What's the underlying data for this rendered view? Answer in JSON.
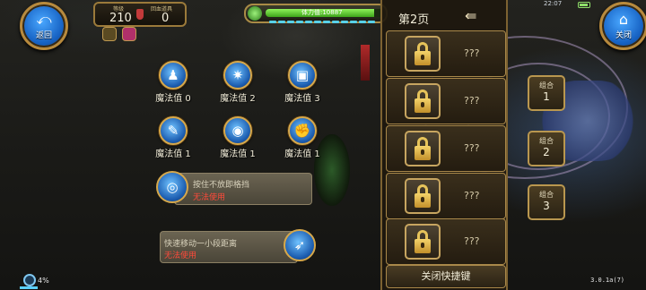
{
  "hud": {
    "back_label": "返回",
    "close_label": "关闭",
    "level_caption": "等级",
    "level_value": "210",
    "potion_caption": "回血道具",
    "potion_value": "0",
    "stamina_text": "体力值:10887",
    "clock": "22:07",
    "hp_fraction": 0.92
  },
  "skills": [
    {
      "name": "魔法值 0",
      "icon": "green-figure-icon"
    },
    {
      "name": "魔法值 2",
      "icon": "star-burst-icon"
    },
    {
      "name": "魔法值 3",
      "icon": "chest-icon"
    },
    {
      "name": "魔法值 1",
      "icon": "feather-icon"
    },
    {
      "name": "魔法值 1",
      "icon": "eye-icon"
    },
    {
      "name": "魔法值 1",
      "icon": "fist-icon"
    }
  ],
  "cards": [
    {
      "text": "按住不放即格挡",
      "status": "无法使用",
      "icon": "shield-icon"
    },
    {
      "text": "快速移动一小段距离",
      "status": "无法使用",
      "icon": "boot-icon"
    }
  ],
  "shortcuts": {
    "page_label": "第2页",
    "slots": [
      "???",
      "???",
      "???",
      "???",
      "???"
    ],
    "close_button": "关闭快捷键"
  },
  "combos": [
    {
      "label": "组合",
      "num": "1"
    },
    {
      "label": "组合",
      "num": "2"
    },
    {
      "label": "组合",
      "num": "3"
    }
  ],
  "footer": {
    "percent": "4%",
    "version": "3.0.1a(7)"
  }
}
